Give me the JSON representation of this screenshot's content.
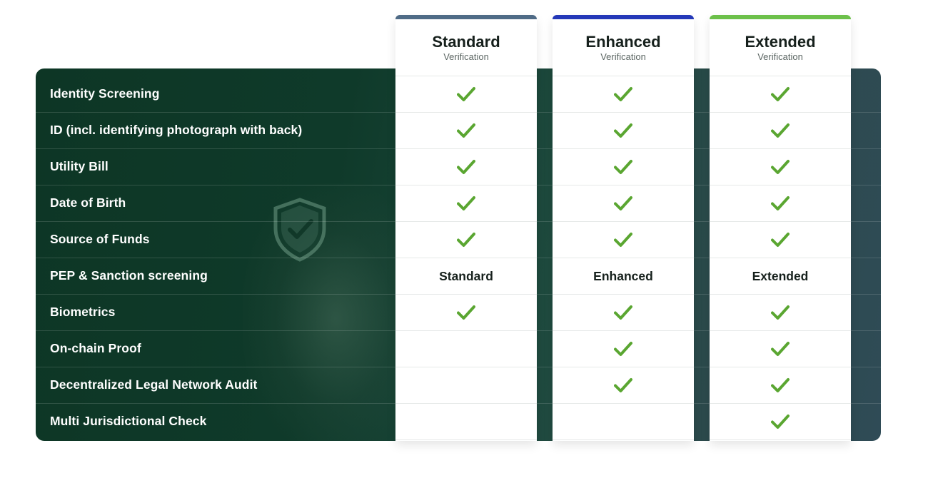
{
  "features": [
    "Identity Screening",
    "ID (incl. identifying photograph with back)",
    "Utility Bill",
    "Date of Birth",
    "Source of Funds",
    "PEP & Sanction screening",
    "Biometrics",
    "On-chain Proof",
    "Decentralized Legal Network Audit",
    "Multi Jurisdictional Check"
  ],
  "plans": [
    {
      "title": "Standard",
      "subtitle": "Verification",
      "accent": "#4f6b86",
      "cells": [
        {
          "check": true
        },
        {
          "check": true
        },
        {
          "check": true
        },
        {
          "check": true
        },
        {
          "check": true
        },
        {
          "text": "Standard"
        },
        {
          "check": true
        },
        {
          "check": false
        },
        {
          "check": false
        },
        {
          "check": false
        }
      ]
    },
    {
      "title": "Enhanced",
      "subtitle": "Verification",
      "accent": "#2438b8",
      "cells": [
        {
          "check": true
        },
        {
          "check": true
        },
        {
          "check": true
        },
        {
          "check": true
        },
        {
          "check": true
        },
        {
          "text": "Enhanced"
        },
        {
          "check": true
        },
        {
          "check": true
        },
        {
          "check": true
        },
        {
          "check": false
        }
      ]
    },
    {
      "title": "Extended",
      "subtitle": "Verification",
      "accent": "#6cc04a",
      "cells": [
        {
          "check": true
        },
        {
          "check": true
        },
        {
          "check": true
        },
        {
          "check": true
        },
        {
          "check": true
        },
        {
          "text": "Extended"
        },
        {
          "check": true
        },
        {
          "check": true
        },
        {
          "check": true
        },
        {
          "check": true
        }
      ]
    }
  ],
  "colors": {
    "check": "#5aa631",
    "panel_dark": "#0d3625",
    "panel_light": "#2f4b56"
  },
  "icons": {
    "check": "checkmark-icon",
    "shield": "shield-check-icon"
  }
}
